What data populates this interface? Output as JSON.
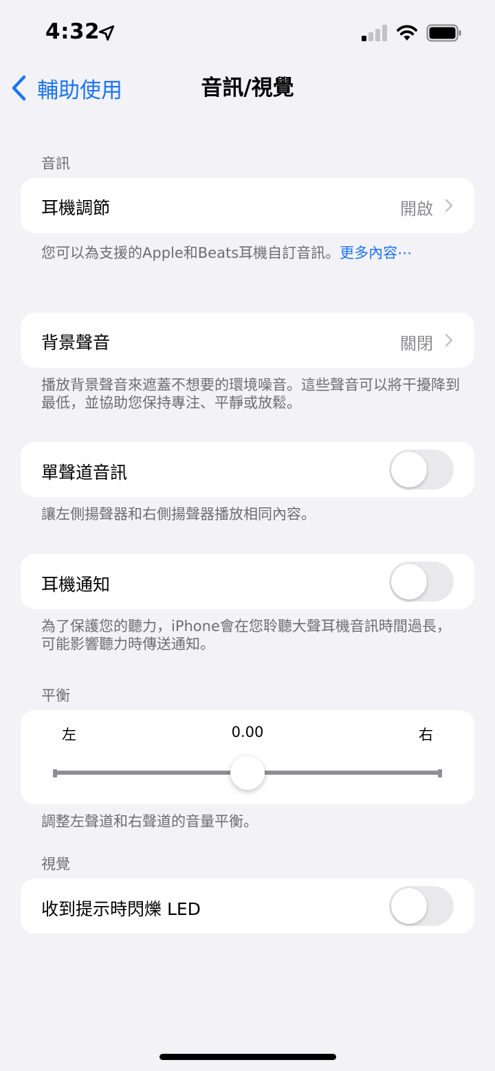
{
  "status_bar": {
    "time": "4:32",
    "icons": [
      "location-arrow-icon",
      "cellular-signal-icon",
      "wifi-icon",
      "battery-icon"
    ]
  },
  "nav": {
    "back_label": "輔助使用",
    "title": "音訊/視覺"
  },
  "sections": {
    "audio_header": "音訊",
    "visual_header": "視覺",
    "balance_header": "平衡"
  },
  "rows": {
    "headphone_accommodations": {
      "label": "耳機調節",
      "value": "開啟"
    },
    "background_sounds": {
      "label": "背景聲音",
      "value": "關閉"
    },
    "mono_audio": {
      "label": "單聲道音訊",
      "on": false
    },
    "headphone_notifications": {
      "label": "耳機通知",
      "on": false
    },
    "led_flash": {
      "label": "收到提示時閃爍 LED",
      "on": false
    }
  },
  "footers": {
    "headphone_accommodations": "您可以為支援的Apple和Beats耳機自訂音訊。",
    "headphone_accommodations_link": "更多內容⋯",
    "background_sounds": "播放背景聲音來遮蓋不想要的環境噪音。這些聲音可以將干擾降到最低，並協助您保持專注、平靜或放鬆。",
    "mono_audio": "讓左側揚聲器和右側揚聲器播放相同內容。",
    "headphone_notifications": "為了保護您的聽力，iPhone會在您聆聽大聲耳機音訊時間過長，可能影響聽力時傳送通知。",
    "balance": "調整左聲道和右聲道的音量平衡。"
  },
  "balance": {
    "left_label": "左",
    "right_label": "右",
    "value_text": "0.00",
    "value": 0.0,
    "min": -1,
    "max": 1
  },
  "colors": {
    "background": "#f2f2f7",
    "accent": "#1d74f5",
    "secondary_text": "#6d6d72",
    "toggle_off": "#e9e9eb"
  }
}
